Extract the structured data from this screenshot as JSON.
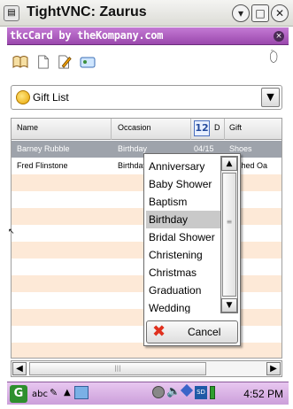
{
  "window": {
    "title": "TightVNC: Zaurus"
  },
  "app": {
    "title": "tkcCard by theKompany.com"
  },
  "toolbar": {
    "icons": [
      "open-book-icon",
      "new-document-icon",
      "edit-pencil-icon",
      "card-icon",
      "touch-icon"
    ]
  },
  "filter": {
    "selected": "Gift List"
  },
  "table": {
    "columns": [
      "Name",
      "Occasion",
      "D",
      "Gift"
    ],
    "rows": [
      {
        "name": "Barney Rubble",
        "occasion": "Birthday",
        "date": "04/15",
        "gift": "Shoes",
        "selected": true
      },
      {
        "name": "Fred Flinstone",
        "occasion": "Birthday",
        "date": "",
        "gift": "olished Oa",
        "selected": false
      }
    ]
  },
  "popup": {
    "items": [
      "Anniversary",
      "Baby Shower",
      "Baptism",
      "Birthday",
      "Bridal Shower",
      "Christening",
      "Christmas",
      "Graduation",
      "Wedding"
    ],
    "highlighted": "Birthday",
    "cancel_label": "Cancel"
  },
  "taskbar": {
    "input_label": "abc",
    "clock": "4:52 PM"
  },
  "colors": {
    "app_title_bar": "#9a48ad",
    "taskbar": "#cb9fda",
    "selected_row": "#9ea3ab",
    "alt_row": "#fde9d7"
  }
}
